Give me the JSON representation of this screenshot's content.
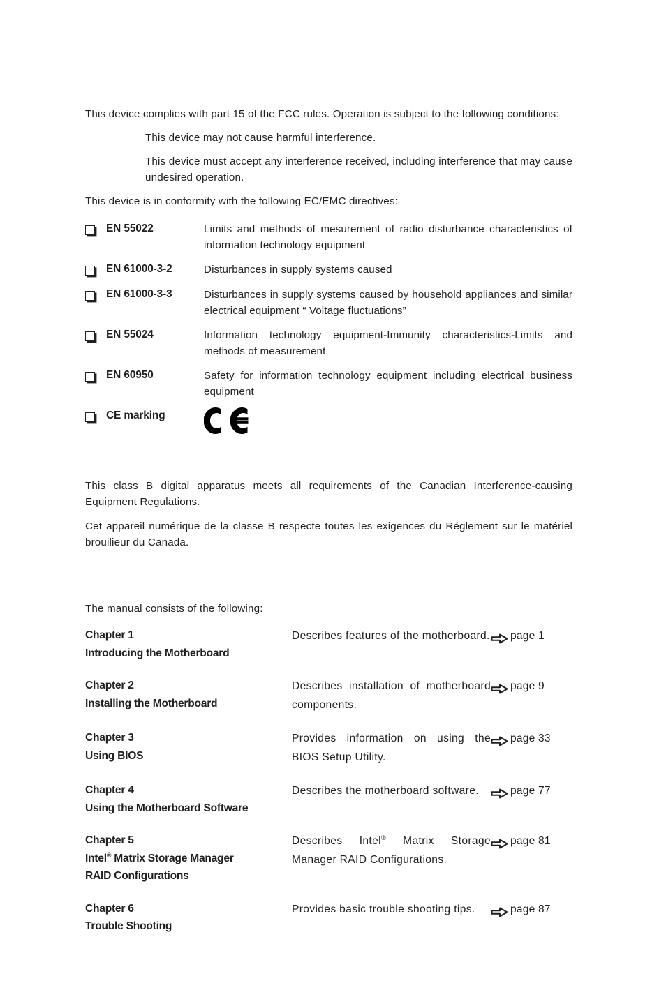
{
  "fcc": {
    "intro": "This device complies with part 15 of the FCC rules. Operation is subject to the following conditions:",
    "conditions": [
      "This device may not cause harmful interference.",
      "This device must accept any interference received, including interference that may cause undesired operation."
    ],
    "directives_intro": "This device is in conformity with the following EC/EMC directives:"
  },
  "standards": [
    {
      "bullet_icon": "shadowed-square-bullet",
      "name": "EN 55022",
      "description": "Limits and methods of mesurement of radio disturbance characteristics of information technology equipment"
    },
    {
      "bullet_icon": "shadowed-square-bullet",
      "name": "EN 61000-3-2",
      "description": "Disturbances in supply systems caused"
    },
    {
      "bullet_icon": "shadowed-square-bullet",
      "name": "EN 61000-3-3",
      "description": "Disturbances in supply systems caused by household appliances and similar electrical equipment “ Voltage fluctuations”"
    },
    {
      "bullet_icon": "shadowed-square-bullet",
      "name": "EN 55024",
      "description": "Information technology equipment-Immunity characteristics-Limits and methods of measurement"
    },
    {
      "bullet_icon": "shadowed-square-bullet",
      "name": "EN 60950",
      "description": "Safety for information technology equipment including electrical business equipment"
    },
    {
      "bullet_icon": "shadowed-square-bullet",
      "name": "CE marking",
      "description": "",
      "logo": "ce-marking-logo"
    }
  ],
  "canada": {
    "english": "This class B digital apparatus meets all requirements of the Canadian Interference-causing Equipment Regulations.",
    "french": "Cet appareil numérique de la classe B respecte toutes les exigences du Réglement sur le matériel brouilieur du Canada."
  },
  "manual": {
    "intro": "The manual consists of the following:",
    "arrow_icon": "hollow-right-arrow-icon",
    "page_prefix": "page",
    "chapters": [
      {
        "number": "Chapter 1",
        "title": "Introducing the Motherboard",
        "title_has_reg": false,
        "description": "Describes features of the motherboard.",
        "page_label": "page 1",
        "page": "1"
      },
      {
        "number": "Chapter 2",
        "title": "Installing the Motherboard",
        "title_has_reg": false,
        "description": "Describes installation of motherboard components.",
        "page_label": "page 9",
        "page": "9"
      },
      {
        "number": "Chapter 3",
        "title": "Using BIOS",
        "title_has_reg": false,
        "description": "Provides information on using the BIOS Setup Utility.",
        "page_label": "page 33",
        "page": "33"
      },
      {
        "number": "Chapter 4",
        "title": "Using the Motherboard Software",
        "title_has_reg": false,
        "description": "Describes the motherboard software.",
        "page_label": "page 77",
        "page": "77"
      },
      {
        "number": "Chapter 5",
        "title_pre_reg": "Intel",
        "title_post_reg": " Matrix Storage Manager",
        "title_line2": "RAID Configurations",
        "title_has_reg": true,
        "description_pre_reg": "Describes Intel",
        "description_post_reg": " Matrix Storage Manager RAID Configurations.",
        "page_label": "page 81",
        "page": "81"
      },
      {
        "number": "Chapter 6",
        "title": "Trouble Shooting",
        "title_has_reg": false,
        "description": "Provides basic trouble shooting tips.",
        "page_label": "page 87",
        "page": "87"
      }
    ]
  },
  "colors": {
    "text": "#231f20",
    "background": "#ffffff"
  }
}
